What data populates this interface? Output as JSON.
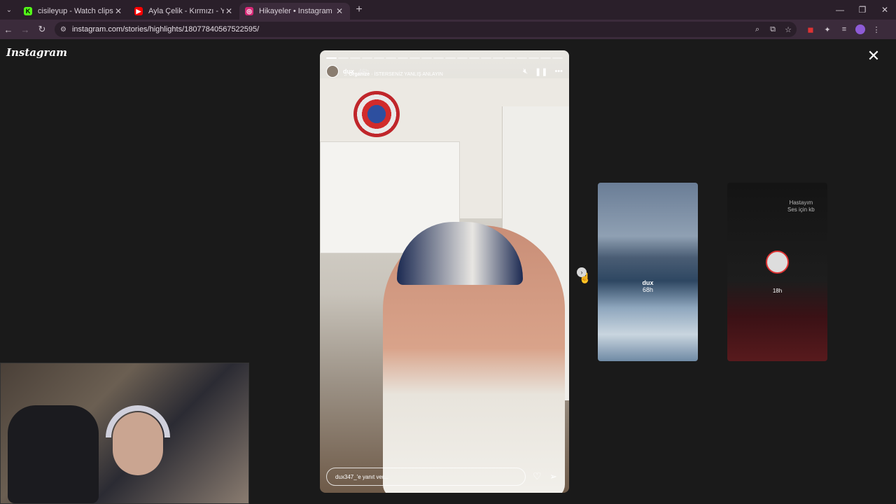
{
  "browser": {
    "tabs": [
      {
        "title": "cisileyup - Watch clips on Kick",
        "favicon": "kick-icon",
        "favicon_color": "#53fc18"
      },
      {
        "title": "Ayla Çelik - Kırmızı - YouTube",
        "favicon": "youtube-icon",
        "favicon_color": "#ff0000"
      },
      {
        "title": "Hikayeler • Instagram",
        "favicon": "instagram-icon",
        "favicon_color": "#d62976"
      }
    ],
    "url": "instagram.com/stories/highlights/18077840567522595/",
    "new_tab": "+"
  },
  "page": {
    "logo": "Instagram",
    "close": "✕"
  },
  "story": {
    "username": "dux",
    "time": "46h",
    "music_label": "Organize",
    "music_title": "İSTERSENİZ YANLIŞ ANLAYIN",
    "reply_placeholder": "dux347_'e yanıt ver...",
    "progress_total": 20,
    "progress_done": 1
  },
  "previews": [
    {
      "username": "dux",
      "time": "68h"
    },
    {
      "note": "Hastayım\nSes için kb",
      "time": "18h"
    }
  ]
}
